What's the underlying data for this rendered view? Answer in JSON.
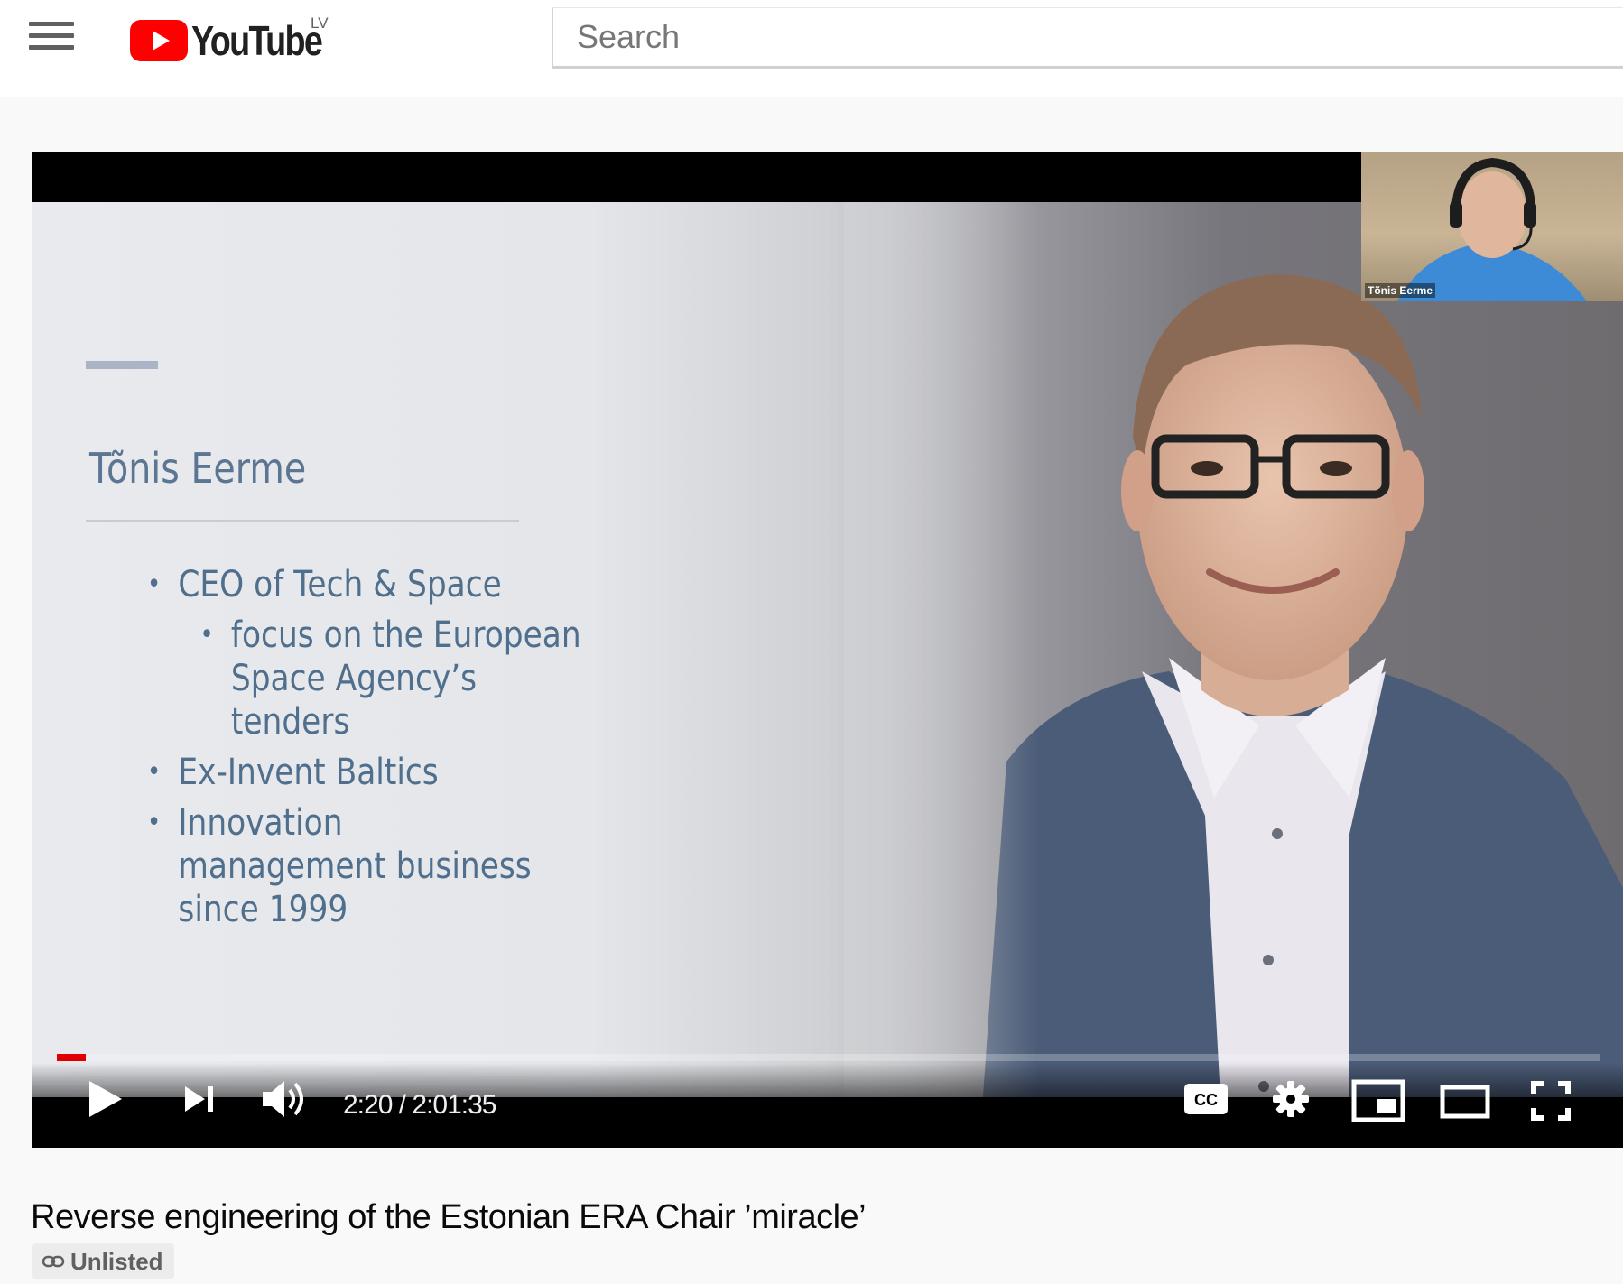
{
  "masthead": {
    "logo_text": "YouTube",
    "region_code": "LV",
    "search": {
      "placeholder": "Search",
      "value": ""
    }
  },
  "player": {
    "slide": {
      "name": "Tõnis Eerme",
      "bullets": [
        {
          "text": "CEO of Tech & Space",
          "level": 1
        },
        {
          "text": "focus on the European Space Agency’s tenders",
          "level": 2
        },
        {
          "text": "Ex-Invent Baltics",
          "level": 1
        },
        {
          "text": "Innovation management business since 1999",
          "level": 1
        }
      ]
    },
    "webcam": {
      "participant_name": "Tõnis Eerme"
    },
    "time": {
      "current": "2:20",
      "duration": "2:01:35",
      "display": "2:20 / 2:01:35"
    },
    "progress_fraction": 0.019,
    "controls": {
      "play": "play-icon",
      "next": "next-icon",
      "volume": "volume-icon",
      "captions": "cc-icon",
      "settings": "gear-icon",
      "miniplayer": "miniplayer-icon",
      "theater": "theater-icon",
      "fullscreen": "fullscreen-icon"
    }
  },
  "video": {
    "title": "Reverse engineering of the Estonian ERA Chair ’miracle’",
    "privacy_badge": "Unlisted"
  },
  "colors": {
    "brand_red": "#ff0000",
    "progress_red": "#e00000",
    "slide_text": "#4f6f8d"
  }
}
